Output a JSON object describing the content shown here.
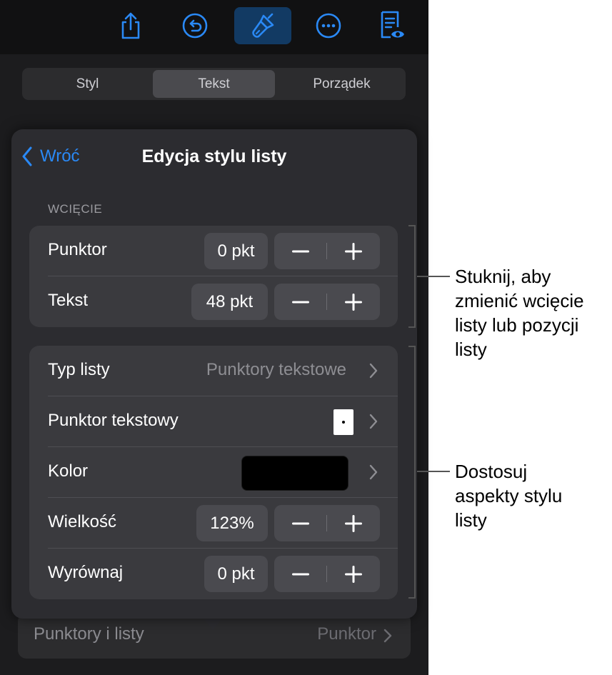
{
  "toolbar": {
    "icons": [
      "share-icon",
      "undo-icon",
      "format-brush-icon",
      "more-icon",
      "reader-view-icon"
    ],
    "active": "format-brush-icon",
    "accent": "#2a89f5"
  },
  "tabs": [
    {
      "label": "Styl",
      "selected": false
    },
    {
      "label": "Tekst",
      "selected": true
    },
    {
      "label": "Porządek",
      "selected": false
    }
  ],
  "popover": {
    "back_label": "Wróć",
    "title": "Edycja stylu listy",
    "section_label": "WCIĘCIE",
    "indent": {
      "bullet": {
        "label": "Punktor",
        "value": "0 pkt"
      },
      "text": {
        "label": "Tekst",
        "value": "48 pkt"
      }
    },
    "style": {
      "list_type": {
        "label": "Typ listy",
        "value": "Punktory tekstowe"
      },
      "text_bullet": {
        "label": "Punktor tekstowy",
        "value": "•"
      },
      "color": {
        "label": "Kolor",
        "swatch": "#000000"
      },
      "size": {
        "label": "Wielkość",
        "value": "123%"
      },
      "align": {
        "label": "Wyrównaj",
        "value": "0 pkt"
      }
    },
    "stepper_minus": "−",
    "stepper_plus": "+"
  },
  "underlying_row": {
    "label": "Punktory i listy",
    "value": "Punktor"
  },
  "callouts": {
    "indent": [
      "Stuknij, aby",
      "zmienić wcięcie",
      "listy lub pozycji",
      "listy"
    ],
    "style": [
      "Dostosuj",
      "aspekty stylu",
      "listy"
    ]
  }
}
